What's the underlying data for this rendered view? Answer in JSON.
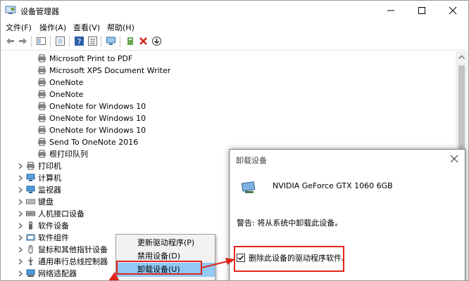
{
  "window": {
    "title": "设备管理器",
    "minimize_glyph": "—",
    "maximize_glyph": "☐",
    "close_glyph": "✕"
  },
  "menu": [
    "文件(F)",
    "操作(A)",
    "查看(V)",
    "帮助(H)"
  ],
  "toolbar_icons": [
    "back-arrow-icon",
    "forward-arrow-icon",
    "properties-icon",
    "show-hidden-icon",
    "help-icon",
    "list-view-icon",
    "monitor-icon",
    "update-driver-icon",
    "remove-device-icon",
    "download-icon"
  ],
  "tree": {
    "printer_children": [
      "Microsoft Print to PDF",
      "Microsoft XPS Document Writer",
      "OneNote",
      "OneNote",
      "OneNote for Windows 10",
      "OneNote for Windows 10",
      "OneNote for Windows 10",
      "Send To OneNote 2016",
      "根打印队列"
    ],
    "categories": [
      "打印机",
      "计算机",
      "监视器",
      "键盘",
      "人机接口设备",
      "软件设备",
      "软件组件",
      "鼠标和其他指针设备",
      "通用串行总线控制器",
      "网络适配器"
    ]
  },
  "context_menu": {
    "items": [
      "更新驱动程序(P)",
      "禁用设备(D)",
      "卸载设备(U)"
    ],
    "highlighted_index": 2
  },
  "dialog": {
    "title": "卸载设备",
    "device_name": "NVIDIA GeForce GTX 1060 6GB",
    "warning": "警告: 将从系统中卸载此设备。",
    "checkbox_label": "删除此设备的驱动程序软件。",
    "checkbox_checked": true
  },
  "colors": {
    "highlight": "#91c9f7",
    "annotation_red": "#e0241b"
  }
}
